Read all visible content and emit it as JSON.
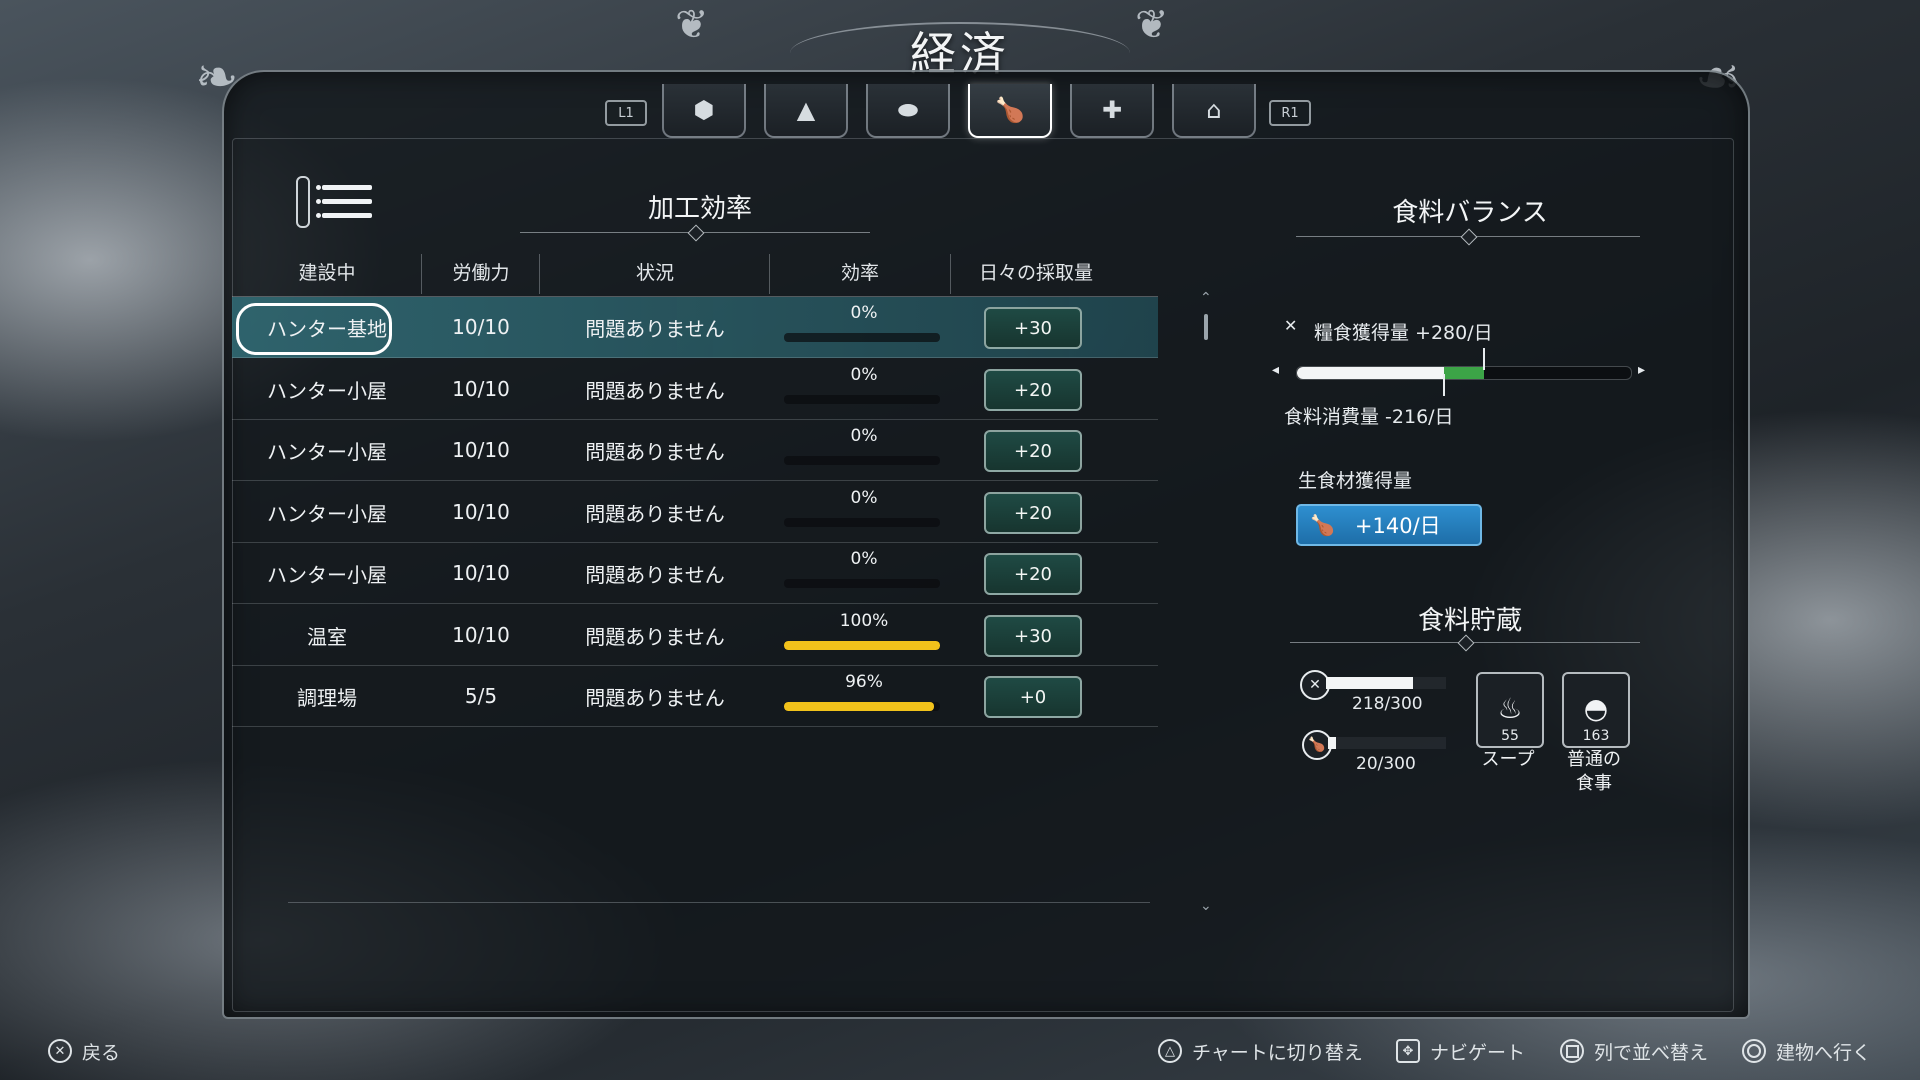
{
  "screen": {
    "title": "経済"
  },
  "tabs": {
    "left_shoulder": "L1",
    "right_shoulder": "R1",
    "items": [
      {
        "icon": "hexagon-icon",
        "glyph": "⬢",
        "active": false
      },
      {
        "icon": "tree-icon",
        "glyph": "▲",
        "active": false
      },
      {
        "icon": "ingot-icon",
        "glyph": "⬬",
        "active": false
      },
      {
        "icon": "meat-icon",
        "glyph": "🍗",
        "active": true
      },
      {
        "icon": "medical-cross-icon",
        "glyph": "✚",
        "active": false
      },
      {
        "icon": "house-icon",
        "glyph": "⌂",
        "active": false
      }
    ]
  },
  "left_panel": {
    "title": "加工効率",
    "columns": [
      "建設中",
      "労働力",
      "状況",
      "効率",
      "日々の採取量"
    ],
    "rows": [
      {
        "name": "ハンター基地",
        "workforce": "10/10",
        "status": "問題ありません",
        "efficiency": "0%",
        "efficiency_value": 0,
        "yield": "+30",
        "selected": true
      },
      {
        "name": "ハンター小屋",
        "workforce": "10/10",
        "status": "問題ありません",
        "efficiency": "0%",
        "efficiency_value": 0,
        "yield": "+20",
        "selected": false
      },
      {
        "name": "ハンター小屋",
        "workforce": "10/10",
        "status": "問題ありません",
        "efficiency": "0%",
        "efficiency_value": 0,
        "yield": "+20",
        "selected": false
      },
      {
        "name": "ハンター小屋",
        "workforce": "10/10",
        "status": "問題ありません",
        "efficiency": "0%",
        "efficiency_value": 0,
        "yield": "+20",
        "selected": false
      },
      {
        "name": "ハンター小屋",
        "workforce": "10/10",
        "status": "問題ありません",
        "efficiency": "0%",
        "efficiency_value": 0,
        "yield": "+20",
        "selected": false
      },
      {
        "name": "温室",
        "workforce": "10/10",
        "status": "問題ありません",
        "efficiency": "100%",
        "efficiency_value": 100,
        "yield": "+30",
        "selected": false
      },
      {
        "name": "調理場",
        "workforce": "5/5",
        "status": "問題ありません",
        "efficiency": "96%",
        "efficiency_value": 96,
        "yield": "+0",
        "selected": false
      }
    ]
  },
  "right_panel": {
    "balance_title": "食料バランス",
    "gain_label": "糧食獲得量 +280/日",
    "consume_label": "食料消費量 -216/日",
    "balance_consumption_fraction": 0.44,
    "balance_gain_fraction": 0.56,
    "raw_gain_label": "生食材獲得量",
    "raw_gain_value": "+140/日",
    "storage_title": "食料貯蔵",
    "rations_stock": "218/300",
    "rations_fraction": 0.727,
    "raw_stock": "20/300",
    "raw_fraction": 0.067,
    "meals": [
      {
        "icon": "soup-bowl-icon",
        "glyph": "♨",
        "count": "55",
        "label": "スープ"
      },
      {
        "icon": "meal-bowl-icon",
        "glyph": "◓",
        "count": "163",
        "label": "普通の\n食事"
      }
    ]
  },
  "footer": {
    "back": "戻る",
    "toggle_chart": "チャートに切り替え",
    "navigate": "ナビゲート",
    "sort_column": "列で並べ替え",
    "go_to_building": "建物へ行く"
  }
}
